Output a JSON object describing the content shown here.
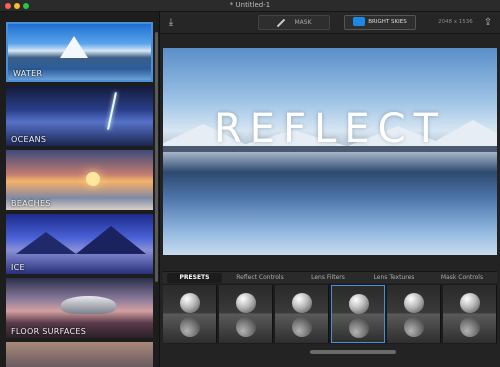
{
  "window": {
    "title": "* Untitled-1"
  },
  "toolbar": {
    "mask_label": "MASK",
    "preset_label": "BRIGHT SKIES",
    "dimensions": "2048 x 1536",
    "save_icon": "download-icon",
    "share_icon": "share-icon"
  },
  "sidebar": {
    "categories": [
      {
        "label": "WATER",
        "selected": true
      },
      {
        "label": "OCEANS"
      },
      {
        "label": "BEACHES"
      },
      {
        "label": "ICE"
      },
      {
        "label": "FLOOR SURFACES"
      }
    ]
  },
  "preview": {
    "overlay_text": "REFLECT"
  },
  "tabs": [
    {
      "label": "PRESETS",
      "active": true
    },
    {
      "label": "Reflect Controls"
    },
    {
      "label": "Lens Filters"
    },
    {
      "label": "Lens Textures"
    },
    {
      "label": "Mask Controls"
    }
  ],
  "thumbnails": {
    "count_visible": 6,
    "selected_index": 3
  },
  "colors": {
    "accent": "#4a90d9",
    "background": "#232323"
  }
}
